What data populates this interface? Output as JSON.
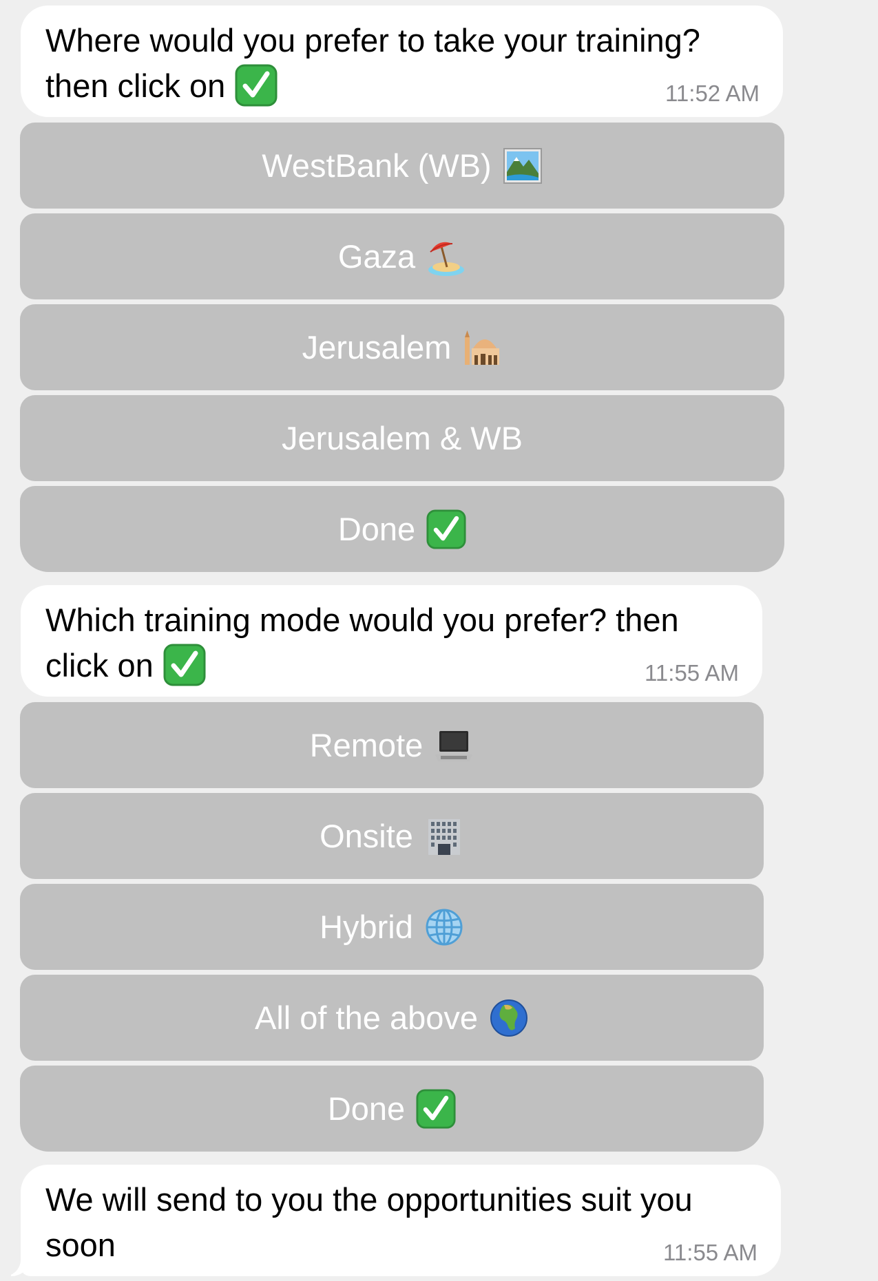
{
  "chat": {
    "messages": [
      {
        "text": "Where would you prefer to take your training? then click on",
        "time": "11:52 AM",
        "buttons": [
          {
            "label": "WestBank (WB)",
            "icon": "landscape-picture-icon"
          },
          {
            "label": "Gaza",
            "icon": "beach-umbrella-island-icon"
          },
          {
            "label": "Jerusalem",
            "icon": "mosque-icon"
          },
          {
            "label": "Jerusalem & WB",
            "icon": ""
          },
          {
            "label": "Done",
            "icon": "check-mark-button-icon"
          }
        ]
      },
      {
        "text": "Which training mode would you prefer? then click on",
        "time": "11:55 AM",
        "buttons": [
          {
            "label": "Remote",
            "icon": "laptop-icon"
          },
          {
            "label": "Onsite",
            "icon": "office-building-icon"
          },
          {
            "label": "Hybrid",
            "icon": "globe-meridians-icon"
          },
          {
            "label": "All of the above",
            "icon": "earth-africa-icon"
          },
          {
            "label": "Done",
            "icon": "check-mark-button-icon"
          }
        ]
      },
      {
        "text": "We will send to you the opportunities suit you soon",
        "time": "11:55 AM"
      }
    ]
  },
  "colors": {
    "background": "#efefef",
    "bubble": "#ffffff",
    "button": "#c0c0c0",
    "button_text": "#ffffff",
    "timestamp": "#8a8a8e",
    "check_green": "#3bb54a"
  }
}
